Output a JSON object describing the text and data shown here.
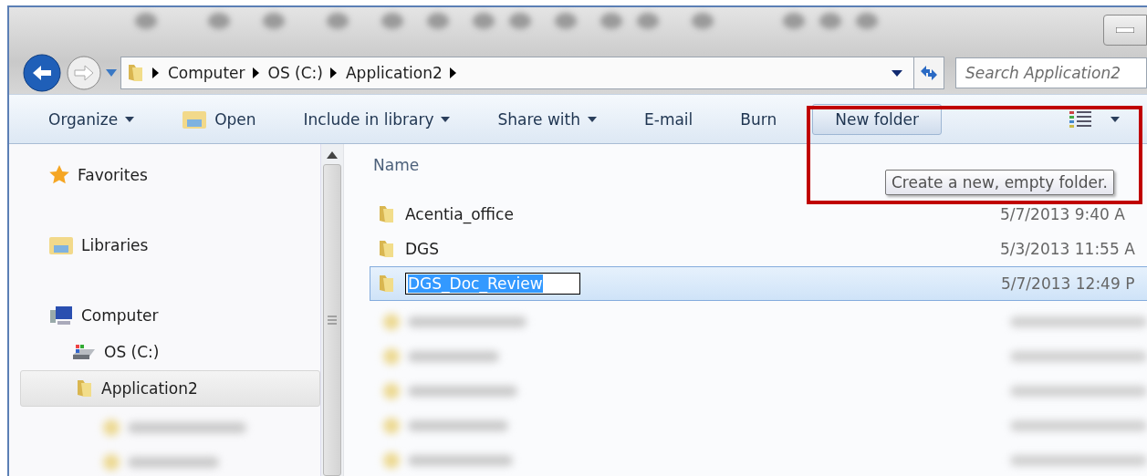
{
  "address_bar": {
    "crumbs": [
      "Computer",
      "OS (C:)",
      "Application2"
    ],
    "search": {
      "placeholder": "Search Application2"
    }
  },
  "toolbar": {
    "items": [
      {
        "label": "Organize",
        "kind": "menu"
      },
      {
        "label": "Open",
        "kind": "open"
      },
      {
        "label": "Include in library",
        "kind": "menu"
      },
      {
        "label": "Share with",
        "kind": "menu"
      },
      {
        "label": "E-mail",
        "kind": "plain"
      },
      {
        "label": "Burn",
        "kind": "plain"
      },
      {
        "label": "New folder",
        "kind": "hovered"
      }
    ]
  },
  "tooltip": {
    "text": "Create a new, empty folder."
  },
  "navigation": {
    "items": [
      {
        "label": "Favorites",
        "kind": "star",
        "selected": false
      },
      {
        "label": "Libraries",
        "kind": "library",
        "selected": false
      },
      {
        "label": "Computer",
        "kind": "computer",
        "selected": false
      },
      {
        "label": "OS (C:)",
        "kind": "drive",
        "selected": false
      },
      {
        "label": "Application2",
        "kind": "folder",
        "selected": true
      }
    ]
  },
  "file_list": {
    "columns": [
      "Name"
    ],
    "rows": [
      {
        "name": "Acentia_office",
        "modified": "5/7/2013 9:40 A",
        "selected": false,
        "editing": false
      },
      {
        "name": "DGS",
        "modified": "5/3/2013 11:55 A",
        "selected": false,
        "editing": false
      },
      {
        "name": "DGS_Doc_Review",
        "modified": "5/7/2013 12:49 P",
        "selected": true,
        "editing": true
      }
    ]
  }
}
